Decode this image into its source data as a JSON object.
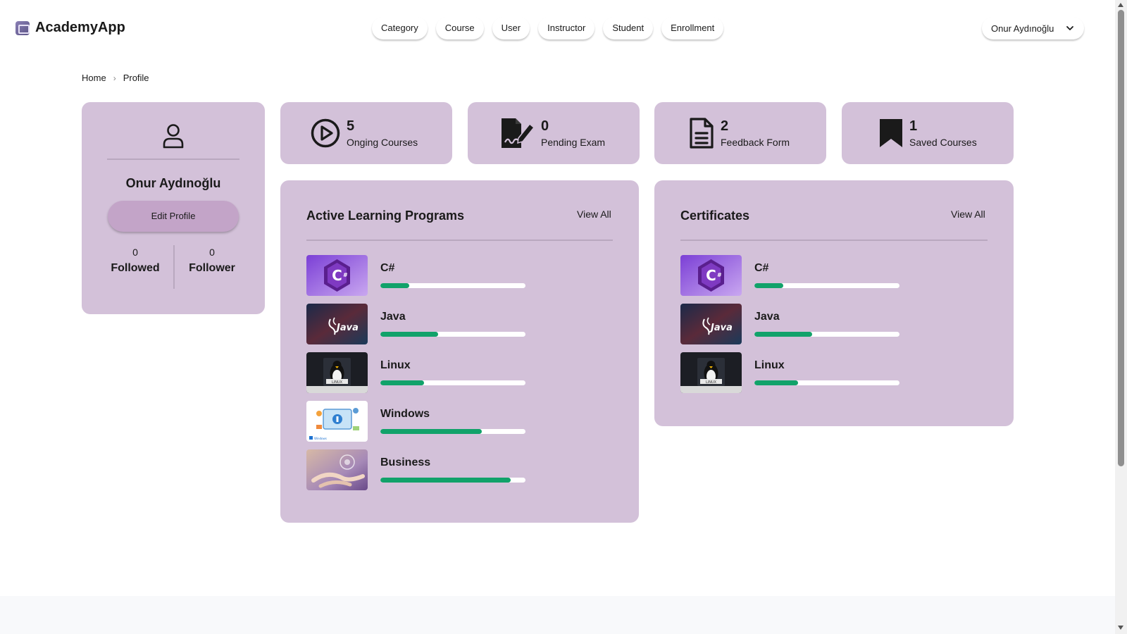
{
  "header": {
    "brand": "AcademyApp",
    "nav": [
      "Category",
      "Course",
      "User",
      "Instructor",
      "Student",
      "Enrollment"
    ],
    "user_name": "Onur Aydınoğlu"
  },
  "breadcrumb": {
    "home": "Home",
    "sep": "›",
    "current": "Profile"
  },
  "profile": {
    "name": "Onur Aydınoğlu",
    "edit_label": "Edit Profile",
    "followed_count": "0",
    "followed_label": "Followed",
    "follower_count": "0",
    "follower_label": "Follower"
  },
  "stats": [
    {
      "icon": "play-circle-icon",
      "value": "5",
      "label": "Onging Courses"
    },
    {
      "icon": "signed-document-icon",
      "value": "0",
      "label": "Pending Exam"
    },
    {
      "icon": "document-icon",
      "value": "2",
      "label": "Feedback Form"
    },
    {
      "icon": "bookmark-icon",
      "value": "1",
      "label": "Saved Courses"
    }
  ],
  "active_programs": {
    "title": "Active Learning Programs",
    "view_all": "View All",
    "items": [
      {
        "name": "C#",
        "progress": 0.2
      },
      {
        "name": "Java",
        "progress": 0.4
      },
      {
        "name": "Linux",
        "progress": 0.3
      },
      {
        "name": "Windows",
        "progress": 0.7
      },
      {
        "name": "Business",
        "progress": 0.9
      }
    ]
  },
  "certificates": {
    "title": "Certificates",
    "view_all": "View All",
    "items": [
      {
        "name": "C#",
        "progress": 0.2
      },
      {
        "name": "Java",
        "progress": 0.4
      },
      {
        "name": "Linux",
        "progress": 0.3
      }
    ]
  },
  "colors": {
    "card": "#d3c1d9",
    "button": "#c3a4c8",
    "progress": "#11a26a"
  }
}
